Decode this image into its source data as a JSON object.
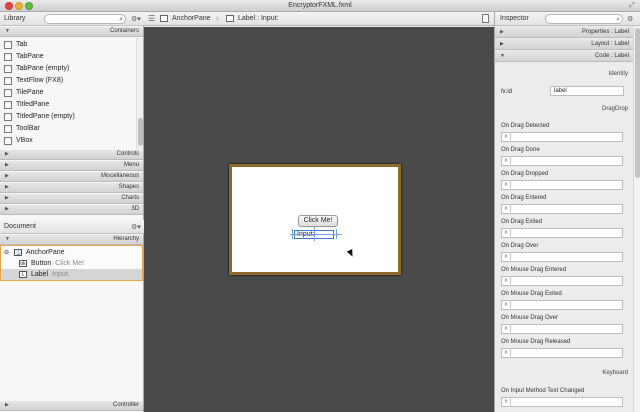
{
  "window": {
    "title": "EncryptorFXML.fxml"
  },
  "library": {
    "title": "Library",
    "containers_label": "Containers",
    "items": [
      {
        "label": "Tab",
        "icon": "tab-icon"
      },
      {
        "label": "TabPane",
        "icon": "tabpane-icon"
      },
      {
        "label": "TabPane  (empty)",
        "icon": "tabpane-icon"
      },
      {
        "label": "TextFlow  (FX8)",
        "icon": "textflow-icon"
      },
      {
        "label": "TilePane",
        "icon": "tilepane-icon"
      },
      {
        "label": "TitledPane",
        "icon": "titledpane-icon"
      },
      {
        "label": "TitledPane  (empty)",
        "icon": "titledpane-icon"
      },
      {
        "label": "ToolBar",
        "icon": "toolbar-icon"
      },
      {
        "label": "VBox",
        "icon": "vbox-icon"
      }
    ],
    "sections": [
      "Controls",
      "Menu",
      "Miscellaneous",
      "Shapes",
      "Charts",
      "3D"
    ]
  },
  "document": {
    "title": "Document",
    "hierarchy_label": "Hierarchy",
    "controller_label": "Controller",
    "tree": [
      {
        "name": "AnchorPane",
        "extra": "",
        "icon": "anchorpane-icon"
      },
      {
        "name": "Button",
        "extra": "Click Me!",
        "icon": "button-icon"
      },
      {
        "name": "Label",
        "extra": "Input:",
        "icon": "label-icon"
      }
    ]
  },
  "breadcrumb": {
    "root": "AnchorPane",
    "current": "Label : Input:"
  },
  "canvas": {
    "button_text": "Click Me!",
    "label_text": "Input:"
  },
  "inspector": {
    "title": "Inspector",
    "sections": [
      {
        "label": "Properties : Label",
        "expanded": false
      },
      {
        "label": "Layout : Label",
        "expanded": false
      },
      {
        "label": "Code : Label",
        "expanded": true
      }
    ],
    "identity_label": "Identity",
    "fxid_label": "fx:id",
    "fxid_value": "label",
    "dragdrop_label": "DragDrop",
    "keyboard_label": "Keyboard",
    "field_prefix": "#",
    "dragdrop_events": [
      "On Drag Detected",
      "On Drag Done",
      "On Drag Dropped",
      "On Drag Entered",
      "On Drag Exited",
      "On Drag Over",
      "On Mouse Drag Entered",
      "On Mouse Drag Exited",
      "On Mouse Drag Over",
      "On Mouse Drag Released"
    ],
    "keyboard_events": [
      "On Input Method Text Changed"
    ]
  },
  "colors": {
    "canvas_bg": "#4a4a4a",
    "anchor_border": "#8e6a2b",
    "selection_orange": "#e7a44b",
    "guide_blue": "#6fa0e0"
  }
}
